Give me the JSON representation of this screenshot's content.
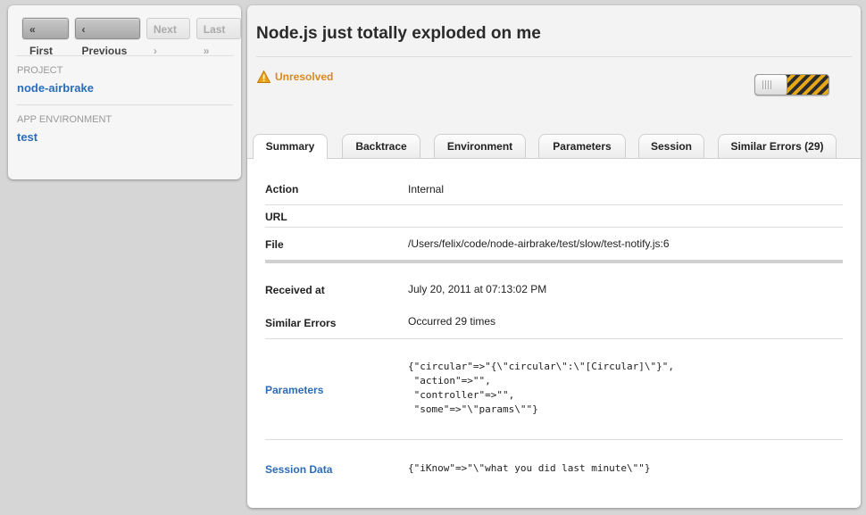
{
  "pager": {
    "first": "« First",
    "previous": "‹ Previous",
    "next": "Next ›",
    "last": "Last »"
  },
  "sidebar": {
    "project_label": "PROJECT",
    "project_value": "node-airbrake",
    "env_label": "APP ENVIRONMENT",
    "env_value": "test"
  },
  "error": {
    "title": "Node.js just totally exploded on me",
    "status": "Unresolved",
    "status_icon": "warning-icon",
    "toggle_state": "off"
  },
  "tabs": [
    {
      "label": "Summary",
      "active": true
    },
    {
      "label": "Backtrace",
      "active": false
    },
    {
      "label": "Environment",
      "active": false
    },
    {
      "label": "Parameters",
      "active": false
    },
    {
      "label": "Session",
      "active": false
    },
    {
      "label": "Similar Errors (29)",
      "active": false
    }
  ],
  "summary": {
    "action_label": "Action",
    "action_value": "Internal",
    "url_label": "URL",
    "url_value": "",
    "file_label": "File",
    "file_value": "/Users/felix/code/node-airbrake/test/slow/test-notify.js:6",
    "received_label": "Received at",
    "received_value": "July 20, 2011 at 07:13:02 PM",
    "similar_label": "Similar Errors",
    "similar_value": "Occurred 29 times",
    "params_label": "Parameters",
    "params_value": "{\"circular\"=>\"{\\\"circular\\\":\\\"[Circular]\\\"}\",\n \"action\"=>\"\",\n \"controller\"=>\"\",\n \"some\"=>\"\\\"params\\\"\"}",
    "session_label": "Session Data",
    "session_value": "{\"iKnow\"=>\"\\\"what you did last minute\\\"\"}"
  },
  "colors": {
    "link": "#2b6cb8",
    "warning": "#d98a1e",
    "toggle_stripe": "#e6a817"
  }
}
